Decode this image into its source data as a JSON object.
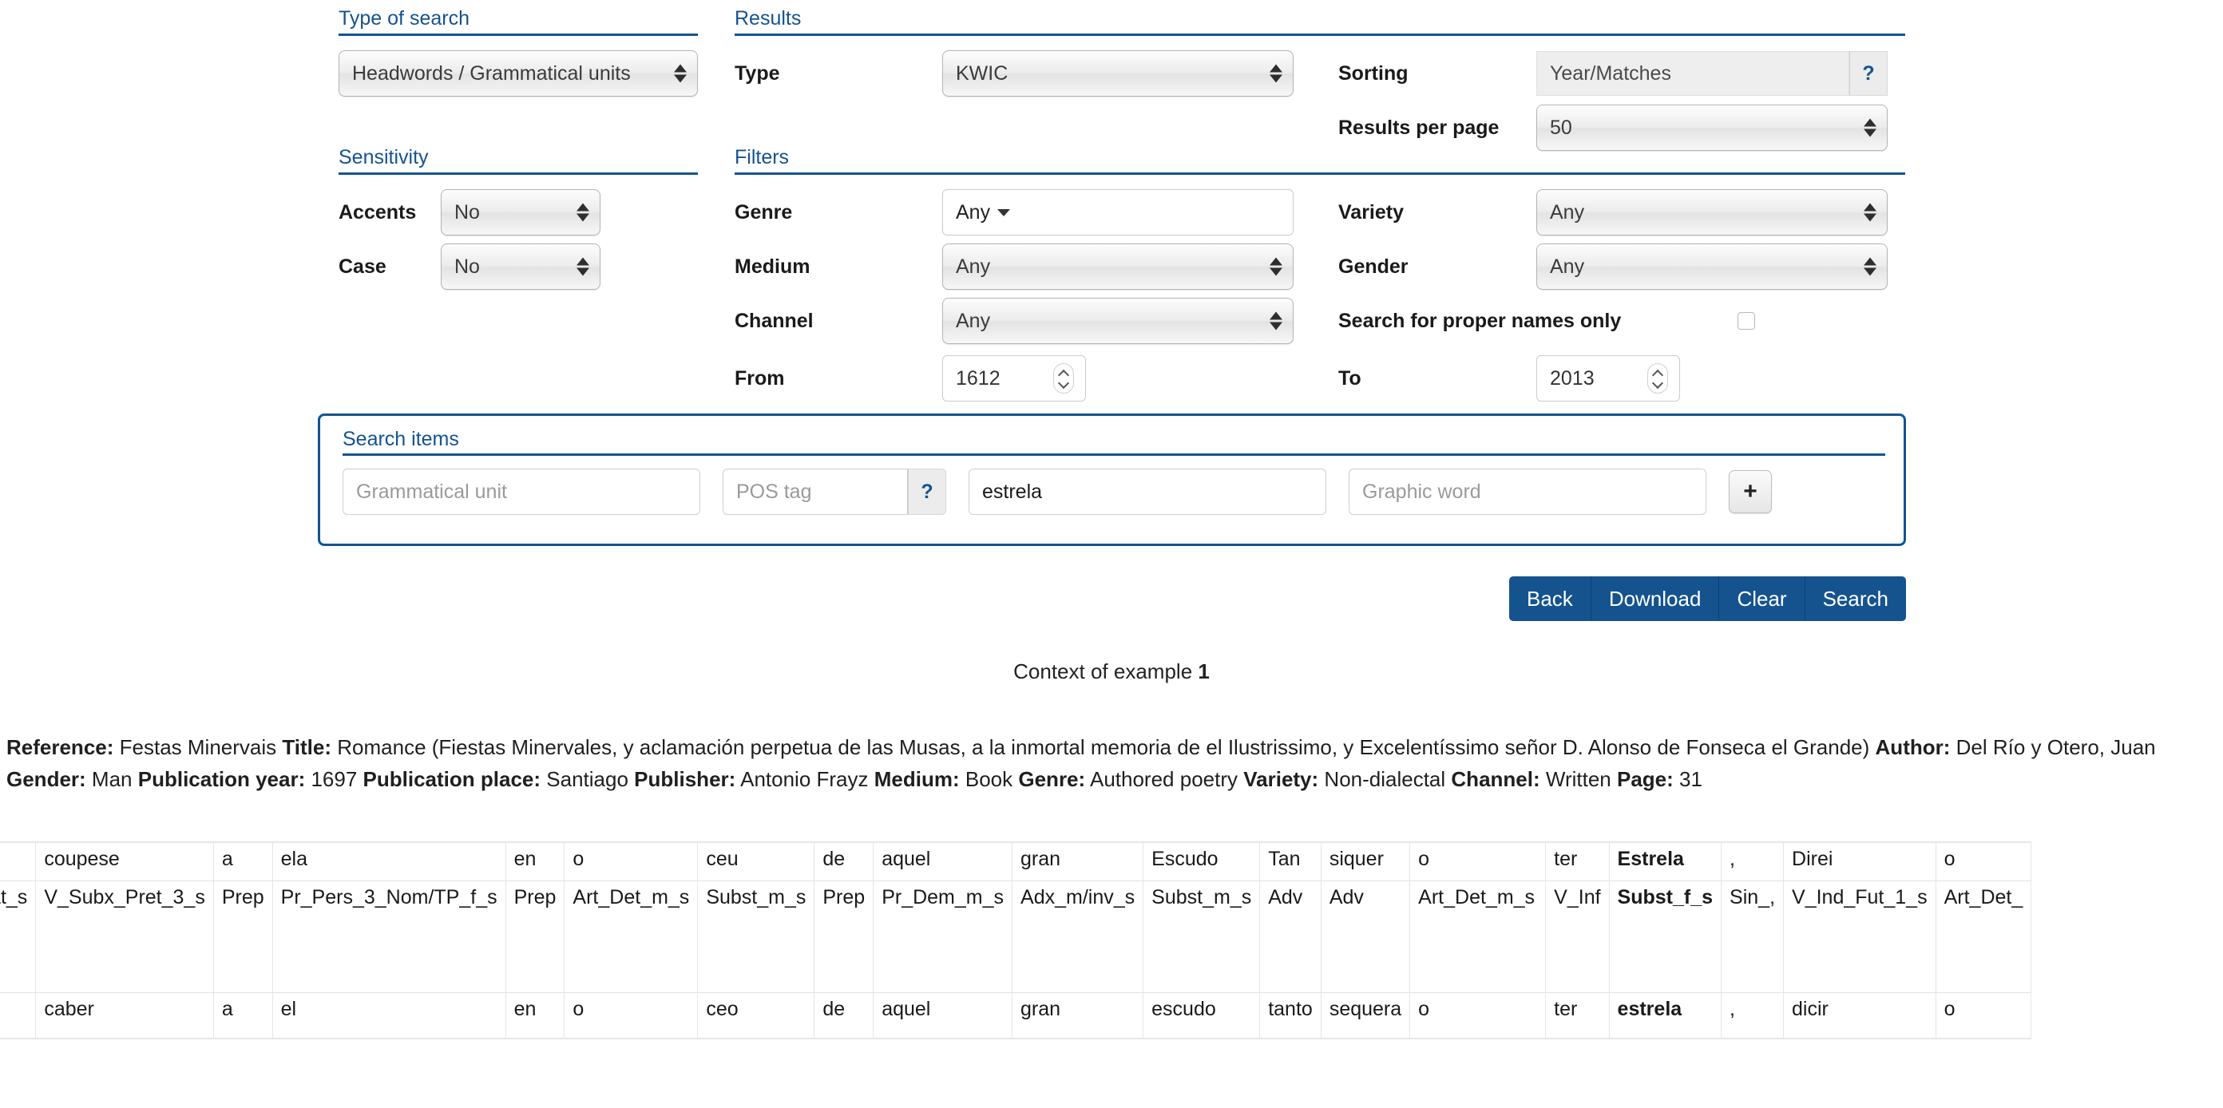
{
  "type_of_search": {
    "heading": "Type of search",
    "select_value": "Headwords / Grammatical units"
  },
  "sensitivity": {
    "heading": "Sensitivity",
    "accents_label": "Accents",
    "accents_value": "No",
    "case_label": "Case",
    "case_value": "No"
  },
  "results": {
    "heading": "Results",
    "type_label": "Type",
    "type_value": "KWIC",
    "sorting_label": "Sorting",
    "sorting_value": "Year/Matches",
    "sorting_help": "?",
    "per_page_label": "Results per page",
    "per_page_value": "50"
  },
  "filters": {
    "heading": "Filters",
    "genre_label": "Genre",
    "genre_value": "Any",
    "medium_label": "Medium",
    "medium_value": "Any",
    "channel_label": "Channel",
    "channel_value": "Any",
    "from_label": "From",
    "from_value": "1612",
    "variety_label": "Variety",
    "variety_value": "Any",
    "gender_label": "Gender",
    "gender_value": "Any",
    "proper_names_label": "Search for proper names only",
    "to_label": "To",
    "to_value": "2013"
  },
  "search_items": {
    "heading": "Search items",
    "grammatical_unit_placeholder": "Grammatical unit",
    "pos_tag_placeholder": "POS tag",
    "pos_tag_help": "?",
    "lemma_value": "estrela",
    "graphic_word_placeholder": "Graphic word",
    "add_label": "+"
  },
  "actions": {
    "back": "Back",
    "download": "Download",
    "clear": "Clear",
    "search": "Search"
  },
  "context": {
    "prefix": "Context of example ",
    "number": "1"
  },
  "reference": {
    "reference_label": "Reference:",
    "reference_value": "Festas Minervais",
    "title_label": "Title:",
    "title_value": "Romance (Fiestas Minervales, y aclamación perpetua de las Musas, a la inmortal memoria de el Ilustrissimo, y Excelentíssimo señor D. Alonso de Fonseca el Grande)",
    "author_label": "Author:",
    "author_value": "Del Río y Otero, Juan",
    "gender_label": "Gender:",
    "gender_value": "Man",
    "pubyear_label": "Publication year:",
    "pubyear_value": "1697",
    "pubplace_label": "Publication place:",
    "pubplace_value": "Santiago",
    "publisher_label": "Publisher:",
    "publisher_value": "Antonio Frayz",
    "medium_label": "Medium:",
    "medium_value": "Book",
    "genre_label": "Genre:",
    "genre_value": "Authored poetry",
    "variety_label": "Variety:",
    "variety_value": "Non-dialectal",
    "channel_label": "Channel:",
    "channel_value": "Written",
    "page_label": "Page:",
    "page_value": "31"
  },
  "kwic_table": {
    "rows": [
      {
        "name": "word-forms",
        "cells": [
          "",
          "coupese",
          "a",
          "ela",
          "en",
          "o",
          "ceu",
          "de",
          "aquel",
          "gran",
          "Escudo",
          "Tan",
          "siquer",
          "o",
          "ter",
          "Estrela",
          ",",
          "Direi",
          "o"
        ],
        "match_index": 15
      },
      {
        "name": "pos-tags",
        "cells": [
          "Dat_s",
          "V_Subx_Pret_3_s",
          "Prep",
          "Pr_Pers_3_Nom/TP_f_s",
          "Prep",
          "Art_Det_m_s",
          "Subst_m_s",
          "Prep",
          "Pr_Dem_m_s",
          "Adx_m/inv_s",
          "Subst_m_s",
          "Adv",
          "Adv",
          "Art_Det_m_s",
          "V_Inf",
          "Subst_f_s",
          "Sin_,",
          "V_Ind_Fut_1_s",
          "Art_Det_"
        ],
        "match_index": 15
      },
      {
        "name": "lemmas",
        "cells": [
          "",
          "caber",
          "a",
          "el",
          "en",
          "o",
          "ceo",
          "de",
          "aquel",
          "gran",
          "escudo",
          "tanto",
          "sequera",
          "o",
          "ter",
          "estrela",
          ",",
          "dicir",
          "o"
        ],
        "match_index": 15
      }
    ],
    "wide_columns": [
      3,
      13,
      17
    ]
  },
  "colors": {
    "accent": "#15538f",
    "panel_border": "#15538f",
    "button_bg": "#15538f"
  }
}
